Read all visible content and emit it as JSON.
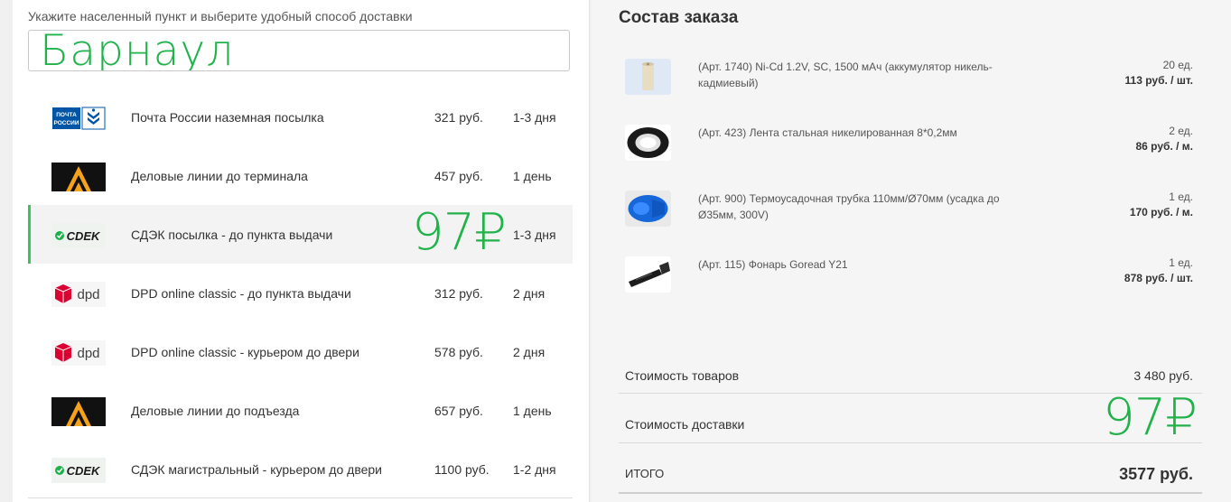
{
  "delivery": {
    "prompt": "Укажите населенный пункт и выберите удобный способ доставки",
    "city": "Барнаул",
    "methods": [
      {
        "logo": "pochta-rossii-logo",
        "logo_text": "ПОЧТА РОССИИ",
        "name": "Почта России наземная посылка",
        "price": "321 руб.",
        "days": "1-3 дня",
        "selected": false
      },
      {
        "logo": "delovye-linii-logo",
        "name": "Деловые линии до терминала",
        "price": "457 руб.",
        "days": "1 день",
        "selected": false
      },
      {
        "logo": "cdek-logo",
        "logo_text": "СDEK",
        "name": "СДЭК посылка - до пункта выдачи",
        "price": "97₽",
        "days": "1-3 дня",
        "selected": true
      },
      {
        "logo": "dpd-logo",
        "logo_text": "dpd",
        "name": "DPD online classic - до пункта выдачи",
        "price": "312 руб.",
        "days": "2 дня",
        "selected": false
      },
      {
        "logo": "dpd-logo",
        "logo_text": "dpd",
        "name": "DPD online classic - курьером до двери",
        "price": "578 руб.",
        "days": "2 дня",
        "selected": false
      },
      {
        "logo": "delovye-linii-logo",
        "name": "Деловые линии до подъезда",
        "price": "657 руб.",
        "days": "1 день",
        "selected": false
      },
      {
        "logo": "cdek-logo",
        "logo_text": "СDEK",
        "name": "СДЭК магистральный - курьером до двери",
        "price": "1100 руб.",
        "days": "1-2 дня",
        "selected": false
      }
    ]
  },
  "order": {
    "title": "Состав заказа",
    "items": [
      {
        "thumb": "battery-thumb",
        "desc": "(Арт. 1740) Ni-Cd 1.2V, SC, 1500 мАч (аккумулятор никель-кадмиевый)",
        "qty": "20 ед.",
        "price": "113 руб. / шт."
      },
      {
        "thumb": "tape-roll-thumb",
        "desc": "(Арт. 423) Лента стальная никелированная 8*0,2мм",
        "qty": "2 ед.",
        "price": "86 руб. / м."
      },
      {
        "thumb": "shrink-tube-thumb",
        "desc": "(Арт. 900) Термоусадочная трубка 110мм/Ø70мм (усадка до Ø35мм, 300V)",
        "qty": "1 ед.",
        "price": "170 руб. / м."
      },
      {
        "thumb": "flashlight-thumb",
        "desc": "(Арт. 115) Фонарь Goread Y21",
        "qty": "1 ед.",
        "price": "878 руб. / шт."
      }
    ],
    "goods_label": "Стоимость товаров",
    "goods_value": "3 480 руб.",
    "delivery_label": "Стоимость доставки",
    "delivery_value": "97₽",
    "total_label": "ИТОГО",
    "total_value": "3577 руб."
  },
  "colors": {
    "accent": "#21b24b",
    "selected_bar": "#3cc161",
    "dpd_red": "#dc0032",
    "cdek_green": "#1ab248",
    "dl_orange": "#f7a21b"
  }
}
